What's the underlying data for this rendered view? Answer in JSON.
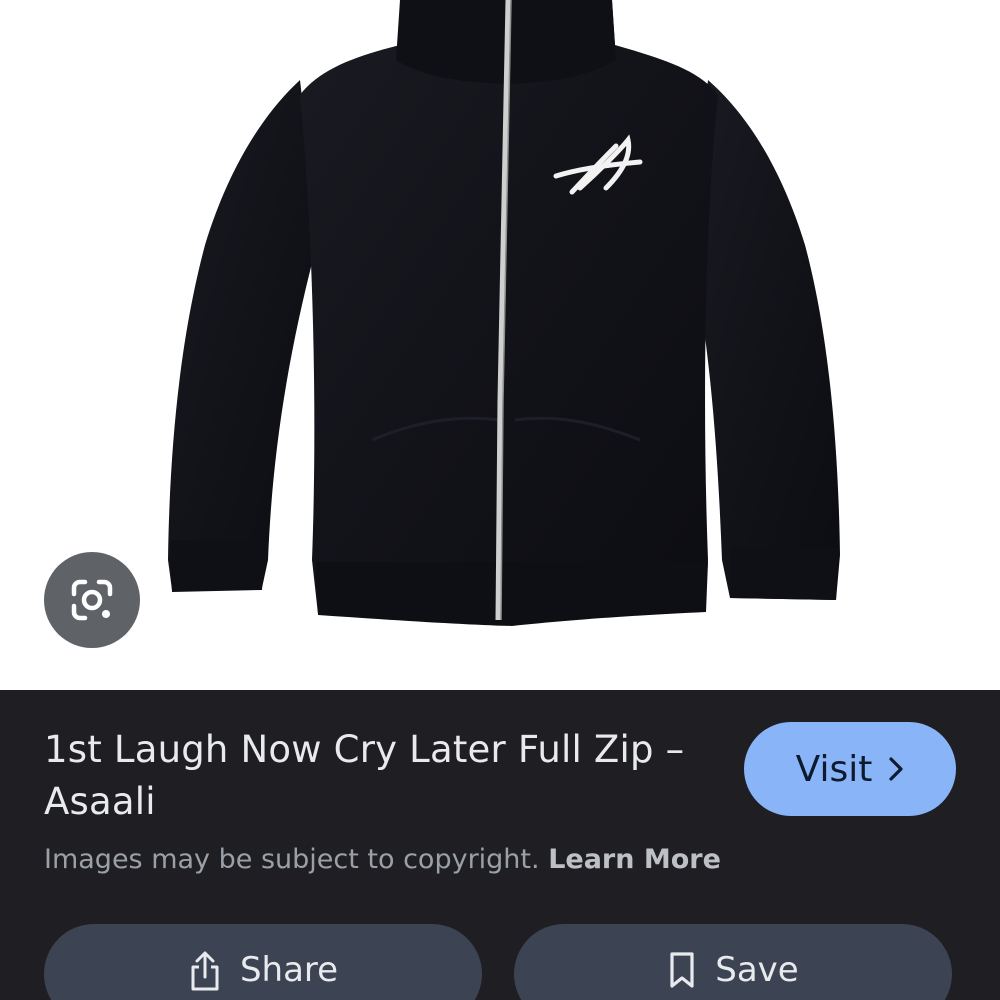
{
  "result": {
    "title": "1st Laugh Now Cry Later Full Zip – Asaali",
    "visit_label": "Visit",
    "copyright_notice": "Images may be subject to copyright.",
    "learn_more_label": "Learn More",
    "share_label": "Share",
    "save_label": "Save"
  },
  "icons": {
    "lens": "google-lens-icon",
    "visit_chevron": "chevron-right-icon",
    "share": "share-icon",
    "save": "bookmark-icon"
  },
  "colors": {
    "panel_background": "#1f1f23",
    "visit_button": "#8ab4f8",
    "action_button": "#3c4453",
    "lens_button": "#5f6368",
    "garment": "#14151b",
    "zipper": "#c8c8c8"
  }
}
